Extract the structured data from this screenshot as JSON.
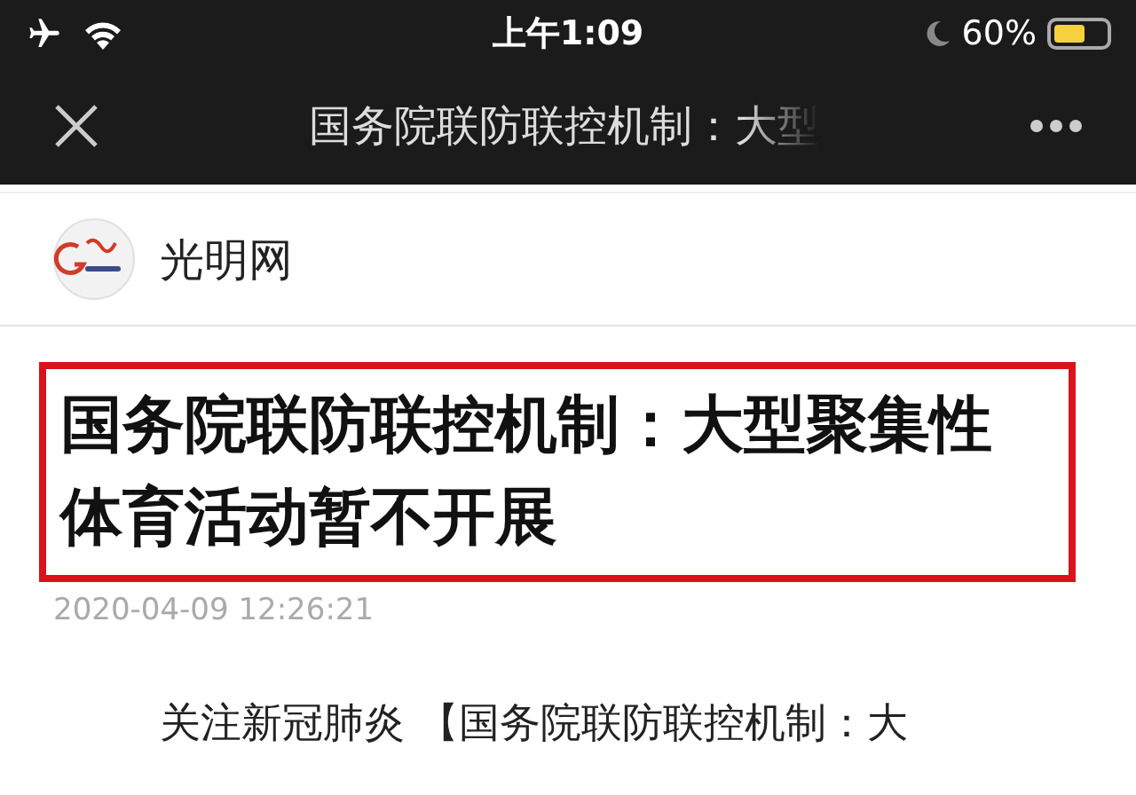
{
  "status_bar": {
    "time": "上午1:09",
    "battery": "60%"
  },
  "nav_bar": {
    "title": "国务院联防联控机制：大型"
  },
  "source": {
    "name": "光明网"
  },
  "article": {
    "title": "国务院联防联控机制：大型聚集性体育活动暂不开展",
    "highlighted": true,
    "date": "2020-04-09 12:26:21",
    "body": "关注新冠肺炎 【国务院联防联控机制：大"
  }
}
